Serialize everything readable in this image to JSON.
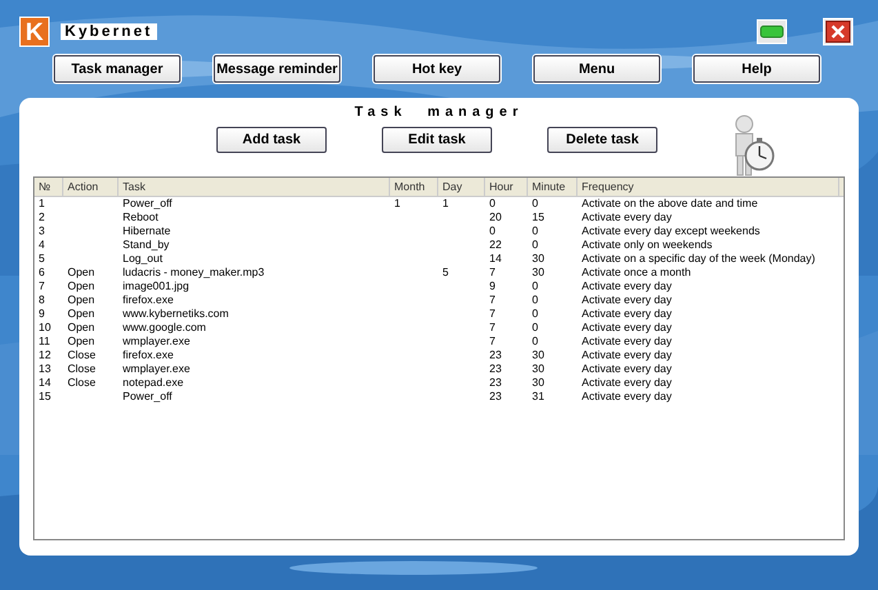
{
  "window": {
    "logo": "K",
    "title": "Kybernet"
  },
  "nav_buttons": [
    "Task manager",
    "Message reminder",
    "Hot key",
    "Menu",
    "Help"
  ],
  "panel": {
    "title": "Task manager",
    "buttons": [
      "Add task",
      "Edit task",
      "Delete task"
    ]
  },
  "table": {
    "columns": [
      "№",
      "Action",
      "Task",
      "Month",
      "Day",
      "Hour",
      "Minute",
      "Frequency"
    ],
    "rows": [
      [
        "1",
        "",
        "Power_off",
        "1",
        "1",
        "0",
        "0",
        "Activate on the above date and time"
      ],
      [
        "2",
        "",
        "Reboot",
        "",
        "",
        "20",
        "15",
        "Activate every day"
      ],
      [
        "3",
        "",
        "Hibernate",
        "",
        "",
        "0",
        "0",
        "Activate every day except weekends"
      ],
      [
        "4",
        "",
        "Stand_by",
        "",
        "",
        "22",
        "0",
        "Activate only on weekends"
      ],
      [
        "5",
        "",
        "Log_out",
        "",
        "",
        "14",
        "30",
        "Activate on a specific day of the week (Monday)"
      ],
      [
        "6",
        "Open",
        "ludacris - money_maker.mp3",
        "",
        "5",
        "7",
        "30",
        "Activate once a month"
      ],
      [
        "7",
        "Open",
        "image001.jpg",
        "",
        "",
        "9",
        "0",
        "Activate every day"
      ],
      [
        "8",
        "Open",
        "firefox.exe",
        "",
        "",
        "7",
        "0",
        "Activate every day"
      ],
      [
        "9",
        "Open",
        "www.kybernetiks.com",
        "",
        "",
        "7",
        "0",
        "Activate every day"
      ],
      [
        "10",
        "Open",
        "www.google.com",
        "",
        "",
        "7",
        "0",
        "Activate every day"
      ],
      [
        "11",
        "Open",
        "wmplayer.exe",
        "",
        "",
        "7",
        "0",
        "Activate every day"
      ],
      [
        "12",
        "Close",
        "firefox.exe",
        "",
        "",
        "23",
        "30",
        "Activate every day"
      ],
      [
        "13",
        "Close",
        "wmplayer.exe",
        "",
        "",
        "23",
        "30",
        "Activate every day"
      ],
      [
        "14",
        "Close",
        "notepad.exe",
        "",
        "",
        "23",
        "30",
        "Activate every day"
      ],
      [
        "15",
        "",
        "Power_off",
        "",
        "",
        "23",
        "31",
        "Activate every day"
      ]
    ]
  }
}
